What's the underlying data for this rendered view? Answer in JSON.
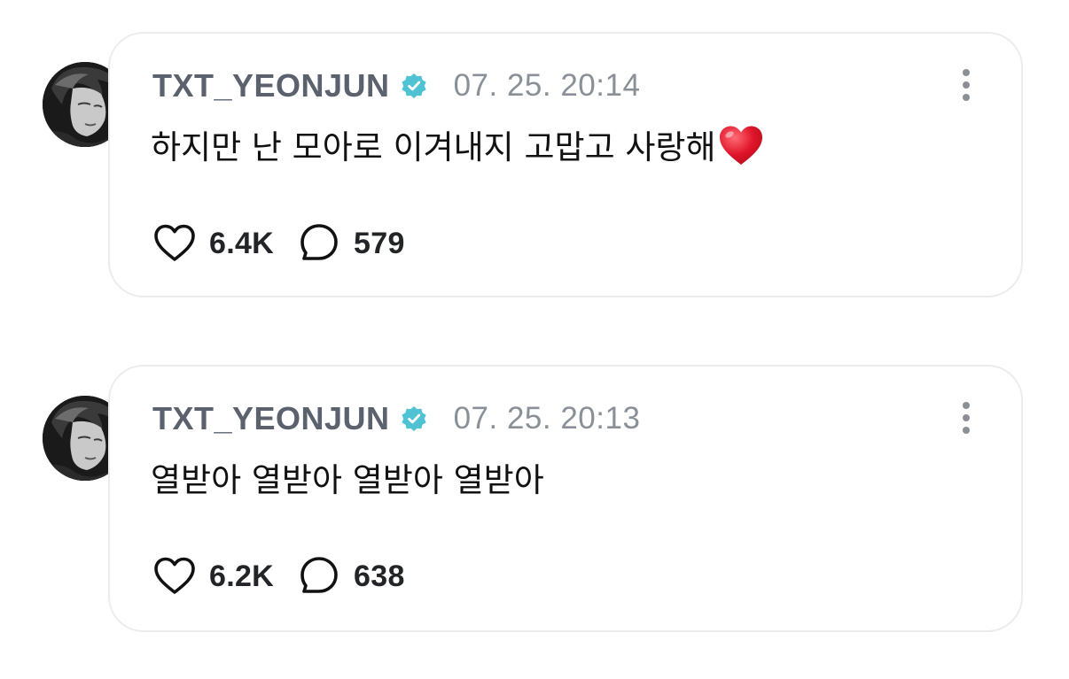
{
  "posts": [
    {
      "username": "TXT_YEONJUN",
      "verified": true,
      "timestamp": "07. 25. 20:14",
      "message": "하지만 난 모아로 이겨내지 고맙고 사랑해",
      "message_emoji": "red-heart",
      "likes": "6.4K",
      "comments": "579"
    },
    {
      "username": "TXT_YEONJUN",
      "verified": true,
      "timestamp": "07. 25. 20:13",
      "message": "열받아 열받아 열받아 열받아",
      "likes": "6.2K",
      "comments": "638"
    }
  ],
  "colors": {
    "username": "#5b626e",
    "timestamp": "#8a9098",
    "verified_badge": "#4fc3d4",
    "card_border": "#ececec",
    "heart_emoji": "#e0152a"
  },
  "icons": {
    "verified": "verified-badge-icon",
    "more": "more-vertical-icon",
    "like": "heart-outline-icon",
    "comment": "speech-bubble-icon"
  }
}
